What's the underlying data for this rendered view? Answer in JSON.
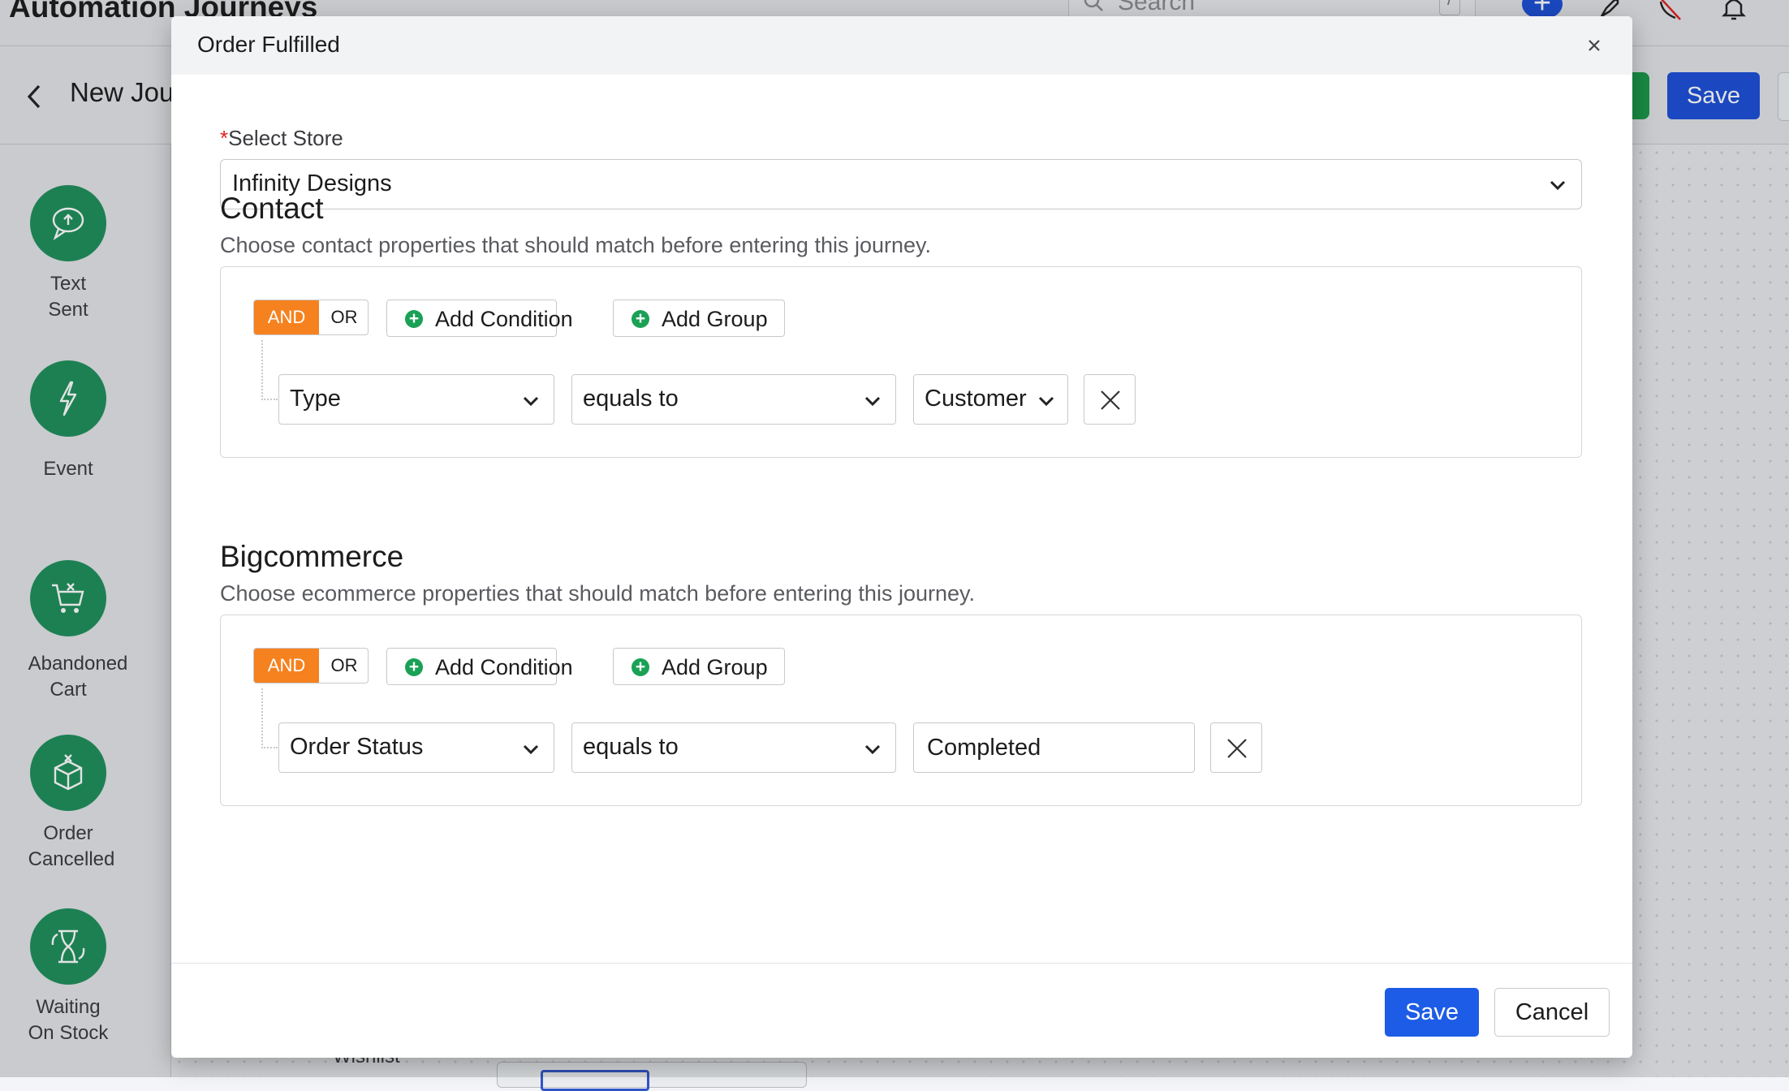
{
  "app": {
    "title": "Automation Journeys",
    "search_placeholder": "Search",
    "search_shortcut": "/",
    "journey_name": "New Jou",
    "save_label": "Save",
    "plus_label": "+"
  },
  "sidebar": {
    "steps": [
      {
        "label_line1": "Text",
        "label_line2": "Sent",
        "icon": "chat-bubble-icon"
      },
      {
        "label_line1": "Event",
        "label_line2": "",
        "icon": "lightning-icon"
      },
      {
        "label_line1": "Abandoned",
        "label_line2": "Cart",
        "icon": "cart-x-icon"
      },
      {
        "label_line1": "Order",
        "label_line2": "Cancelled",
        "icon": "box-x-icon"
      },
      {
        "label_line1": "Waiting",
        "label_line2": "On Stock",
        "icon": "hourglass-icon"
      }
    ],
    "partial_label": "Wishlist"
  },
  "modal": {
    "title": "Order Fulfilled",
    "store": {
      "required_mark": "*",
      "label": "Select Store",
      "value": "Infinity Designs"
    },
    "contact": {
      "title": "Contact",
      "description": "Choose contact properties that should match before entering this journey.",
      "and_label": "AND",
      "or_label": "OR",
      "add_condition": "Add Condition",
      "add_group": "Add Group",
      "condition": {
        "field": "Type",
        "operator": "equals to",
        "value": "Customer"
      }
    },
    "bigcommerce": {
      "title": "Bigcommerce",
      "description": "Choose ecommerce properties that should match before entering this journey.",
      "and_label": "AND",
      "or_label": "OR",
      "add_condition": "Add Condition",
      "add_group": "Add Group",
      "condition": {
        "field": "Order Status",
        "operator": "equals to",
        "value": "Completed"
      }
    },
    "footer": {
      "save": "Save",
      "cancel": "Cancel"
    }
  },
  "colors": {
    "primary": "#1d5ce6",
    "and_active": "#f5821f",
    "add_plus": "#1aa155",
    "step_circle": "#1f8f5c",
    "required": "#e02020"
  }
}
